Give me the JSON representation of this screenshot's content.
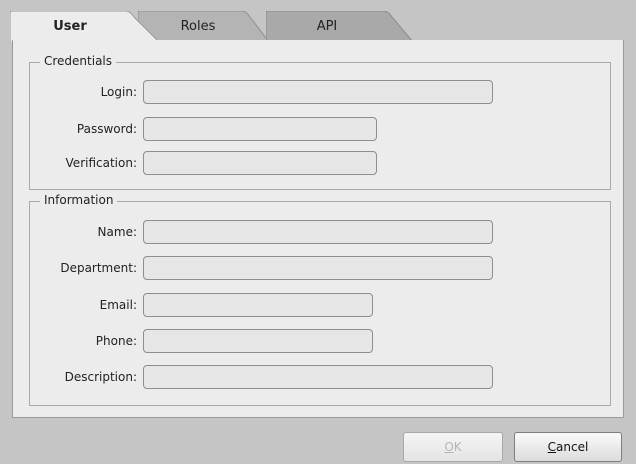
{
  "tabs": [
    {
      "label": "User",
      "active": true
    },
    {
      "label": "Roles",
      "active": false
    },
    {
      "label": "API",
      "active": false
    }
  ],
  "credentials": {
    "legend": "Credentials",
    "login_label": "Login:",
    "login_value": "",
    "password_label": "Password:",
    "password_value": "",
    "verification_label": "Verification:",
    "verification_value": ""
  },
  "information": {
    "legend": "Information",
    "name_label": "Name:",
    "name_value": "",
    "department_label": "Department:",
    "department_value": "",
    "email_label": "Email:",
    "email_value": "",
    "phone_label": "Phone:",
    "phone_value": "",
    "description_label": "Description:",
    "description_value": ""
  },
  "buttons": {
    "ok_mnemonic": "O",
    "ok_rest": "K",
    "ok_enabled": false,
    "cancel_mnemonic": "C",
    "cancel_rest": "ancel"
  },
  "colors": {
    "window_bg": "#c5c5c5",
    "panel_bg": "#ececec",
    "field_bg": "#e6e6e6",
    "disabled_text": "#b5b5b5"
  }
}
